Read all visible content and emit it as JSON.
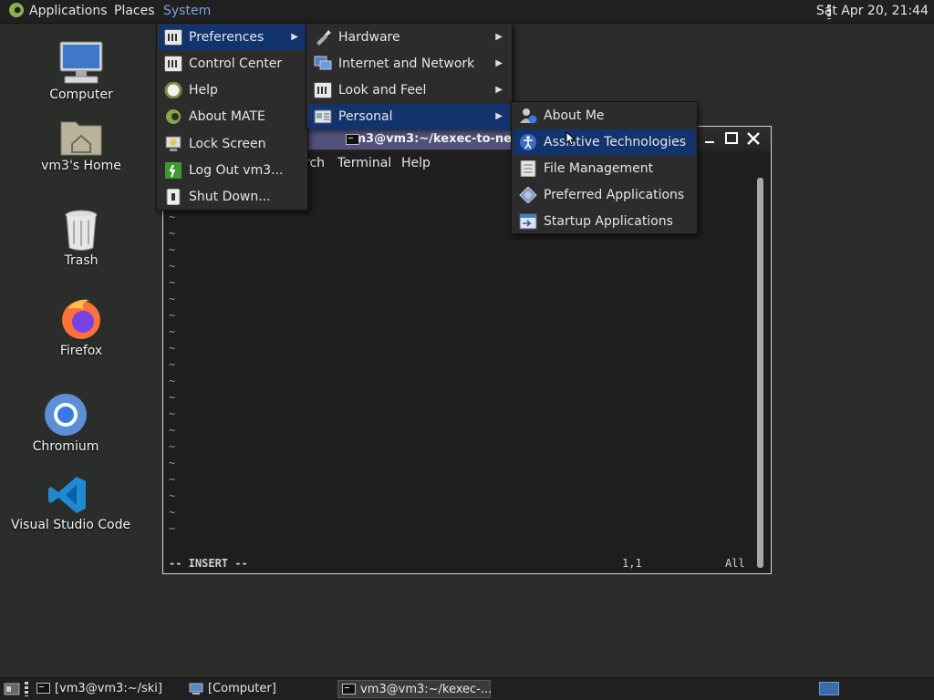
{
  "top_panel": {
    "applications": "Applications",
    "places": "Places",
    "system": "System",
    "clock": "Sat Apr 20, 21:44"
  },
  "desktop": {
    "icons": [
      {
        "label": "Computer",
        "icon": "computer-icon"
      },
      {
        "label": "vm3's Home",
        "icon": "home-folder-icon"
      },
      {
        "label": "Trash",
        "icon": "trash-icon"
      },
      {
        "label": "Firefox",
        "icon": "firefox-icon"
      },
      {
        "label": "Chromium",
        "icon": "chromium-icon"
      },
      {
        "label": "Visual Studio Code",
        "icon": "vscode-icon"
      }
    ]
  },
  "system_menu": {
    "items": [
      {
        "label": "Preferences",
        "icon": "preferences-icon",
        "submenu": true
      },
      {
        "label": "Control Center",
        "icon": "control-center-icon"
      },
      {
        "label": "Help",
        "icon": "help-icon"
      },
      {
        "label": "About MATE",
        "icon": "mate-icon"
      },
      {
        "label": "Lock Screen",
        "icon": "lock-screen-icon"
      },
      {
        "label": "Log Out vm3...",
        "icon": "logout-icon"
      },
      {
        "label": "Shut Down...",
        "icon": "shutdown-icon"
      }
    ]
  },
  "preferences_menu": {
    "items": [
      {
        "label": "Hardware",
        "icon": "hardware-icon",
        "submenu": true
      },
      {
        "label": "Internet and Network",
        "icon": "network-icon",
        "submenu": true
      },
      {
        "label": "Look and Feel",
        "icon": "look-feel-icon",
        "submenu": true
      },
      {
        "label": "Personal",
        "icon": "personal-icon",
        "submenu": true
      }
    ]
  },
  "personal_menu": {
    "items": [
      {
        "label": "About Me",
        "icon": "about-me-icon"
      },
      {
        "label": "Assistive Technologies",
        "icon": "accessibility-icon"
      },
      {
        "label": "File Management",
        "icon": "file-management-icon"
      },
      {
        "label": "Preferred Applications",
        "icon": "preferred-apps-icon"
      },
      {
        "label": "Startup Applications",
        "icon": "startup-apps-icon"
      }
    ]
  },
  "terminal": {
    "tab_title": "vm3@vm3:~/kexec-to-new",
    "menu": [
      "rch",
      "Terminal",
      "Help"
    ],
    "vim_mode": "-- INSERT --",
    "vim_position": "1,1",
    "vim_scroll": "All",
    "tilde": "~"
  },
  "bottom_panel": {
    "tasks": [
      {
        "label": "[vm3@vm3:~/ski]"
      },
      {
        "label": "[Computer]"
      },
      {
        "label": "vm3@vm3:~/kexec-..."
      }
    ]
  },
  "colors": {
    "menu_highlight": "#12346e",
    "system_menu_text": "#7aa3e0",
    "terminal_tab": "#51527a"
  }
}
